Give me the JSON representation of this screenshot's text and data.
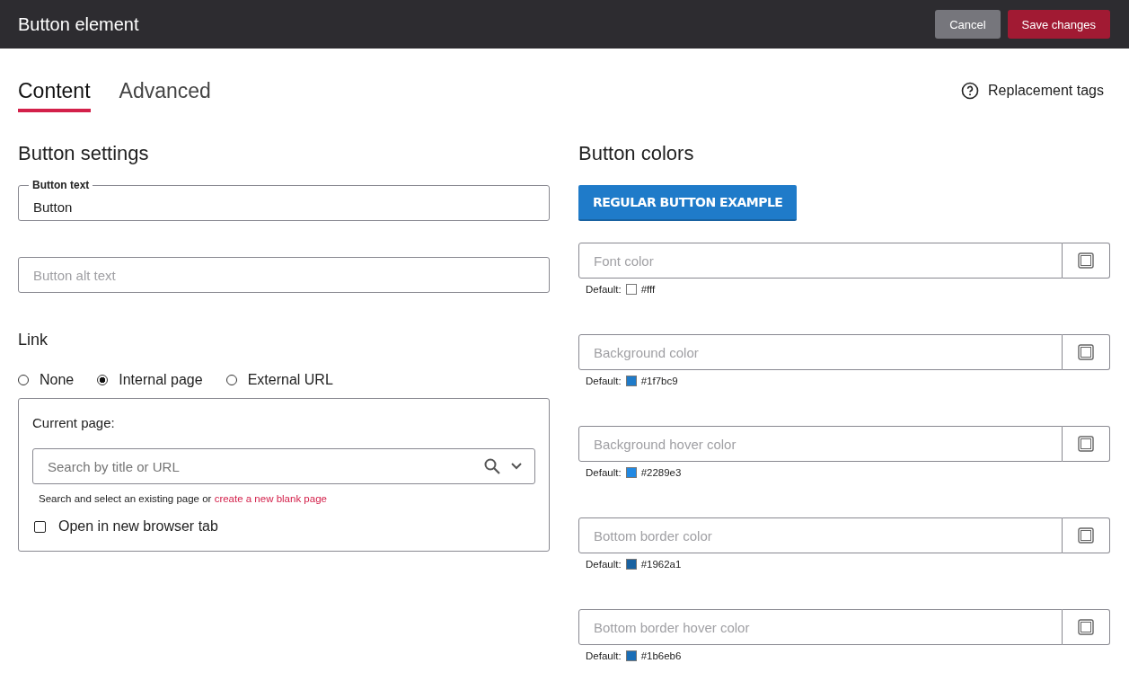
{
  "header": {
    "title": "Button element",
    "buttons": [
      {
        "label": "Cancel",
        "kind": "secondary"
      },
      {
        "label": "Save changes",
        "kind": "primary"
      }
    ]
  },
  "tabs": [
    {
      "label": "Content",
      "selected": true
    },
    {
      "label": "Advanced",
      "selected": false
    }
  ],
  "help_link": "Replacement tags",
  "settings": {
    "heading": "Button settings",
    "button_text": {
      "label": "Button text",
      "value": "Button"
    },
    "alt_text": {
      "placeholder": "Button alt text"
    },
    "link": {
      "heading": "Link",
      "options": [
        {
          "label": "None",
          "selected": false
        },
        {
          "label": "Internal page",
          "selected": true
        },
        {
          "label": "External URL",
          "selected": false
        }
      ],
      "current_page_label": "Current page:",
      "search": {
        "placeholder": "Search by title or URL"
      },
      "hint": "Search and select an existing page or",
      "hint_link": "create a new blank page",
      "new_tab": {
        "label": "Open in new browser tab",
        "checked": false
      }
    }
  },
  "colors": {
    "heading": "Button colors",
    "example_button": "REGULAR BUTTON EXAMPLE",
    "fields": [
      {
        "placeholder": "Font color",
        "default_label": "Default:",
        "default_value": "#fff",
        "color": "#ffffff"
      },
      {
        "placeholder": "Background color",
        "default_label": "Default:",
        "default_value": "#1f7bc9",
        "color": "#1f7bc9"
      },
      {
        "placeholder": "Background hover color",
        "default_label": "Default:",
        "default_value": "#2289e3",
        "color": "#2289e3"
      },
      {
        "placeholder": "Bottom border color",
        "default_label": "Default:",
        "default_value": "#1962a1",
        "color": "#1962a1"
      },
      {
        "placeholder": "Bottom border hover color",
        "default_label": "Default:",
        "default_value": "#1b6eb6",
        "color": "#1b6eb6"
      }
    ]
  }
}
